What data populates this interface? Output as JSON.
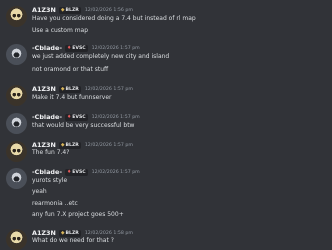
{
  "messages": [
    {
      "author": "A1Z3N",
      "tag": "BLZR",
      "tag_icon": "shield-icon",
      "time": "12/02/2026 1:56 pm",
      "avatar": "a",
      "lines": [
        "Have you considered doing a 7.4 but instead of rl map",
        "Use a custom map"
      ]
    },
    {
      "author": "-Cblade-",
      "tag": "EVSC",
      "tag_icon": "flame-icon",
      "time": "12/02/2026 1:57 pm",
      "avatar": "c",
      "lines": [
        "we just added completely new city and island",
        "not oramond or that stuff"
      ]
    },
    {
      "author": "A1Z3N",
      "tag": "BLZR",
      "tag_icon": "shield-icon",
      "time": "12/02/2026 1:57 pm",
      "avatar": "a",
      "lines": [
        "Make it 7.4 but funnserver"
      ]
    },
    {
      "author": "-Cblade-",
      "tag": "EVSC",
      "tag_icon": "flame-icon",
      "time": "12/02/2026 1:57 pm",
      "avatar": "c",
      "lines": [
        "that would be very successful btw"
      ]
    },
    {
      "author": "A1Z3N",
      "tag": "BLZR",
      "tag_icon": "shield-icon",
      "time": "12/02/2026 1:57 pm",
      "avatar": "a",
      "lines": [
        "The fun 7.4?"
      ]
    },
    {
      "author": "-Cblade-",
      "tag": "EVSC",
      "tag_icon": "flame-icon",
      "time": "12/02/2026 1:57 pm",
      "avatar": "c",
      "lines": [
        "yurots style",
        "yeah",
        "rearmonia ..etc",
        "any fun 7.X project goes 500+"
      ]
    },
    {
      "author": "A1Z3N",
      "tag": "BLZR",
      "tag_icon": "shield-icon",
      "time": "12/02/2026 1:58 pm",
      "avatar": "a",
      "lines": [
        "What do we need for that ?"
      ]
    }
  ]
}
